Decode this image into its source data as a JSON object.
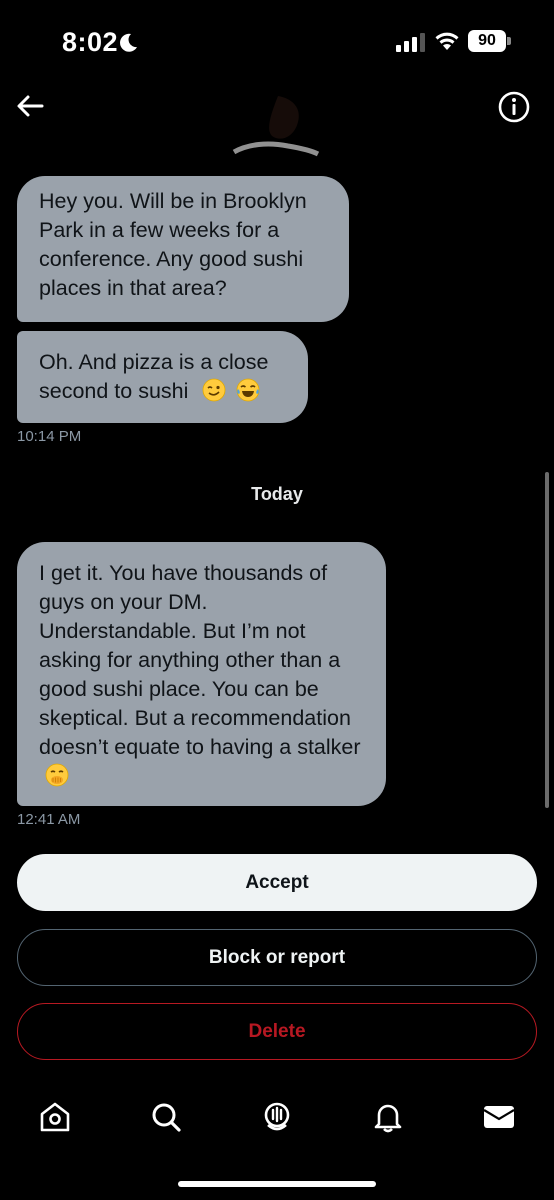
{
  "status_bar": {
    "time": "8:02",
    "battery": "90",
    "icons": [
      "moon-icon",
      "signal-icon",
      "wifi-icon",
      "battery-icon"
    ]
  },
  "header": {
    "back_icon": "back-arrow-icon",
    "info_icon": "info-icon"
  },
  "messages": [
    {
      "text": "Hey you.  Will be in Brooklyn Park in a few weeks for a conference. Any good sushi places in that area?"
    },
    {
      "text": "Oh.  And pizza is a close second to sushi",
      "emojis": [
        "winking-face-emoji",
        "tears-of-joy-emoji"
      ]
    },
    {
      "text": "I get it.  You have thousands of guys on your DM.  Understandable.  But I’m not asking for anything other than a good sushi place.  You can be skeptical.  But a recommendation doesn’t equate to having a stalker",
      "emojis": [
        "hand-over-mouth-emoji"
      ]
    }
  ],
  "timestamps": [
    "10:14 PM",
    "12:41 AM"
  ],
  "day_separator": "Today",
  "actions": {
    "accept": "Accept",
    "block_report": "Block or report",
    "delete": "Delete"
  },
  "tab_bar": [
    "home-icon",
    "search-icon",
    "spaces-icon",
    "notifications-icon",
    "messages-icon"
  ],
  "colors": {
    "bubble": "#9aa2ab",
    "background": "#000000",
    "delete": "#f4212e"
  }
}
